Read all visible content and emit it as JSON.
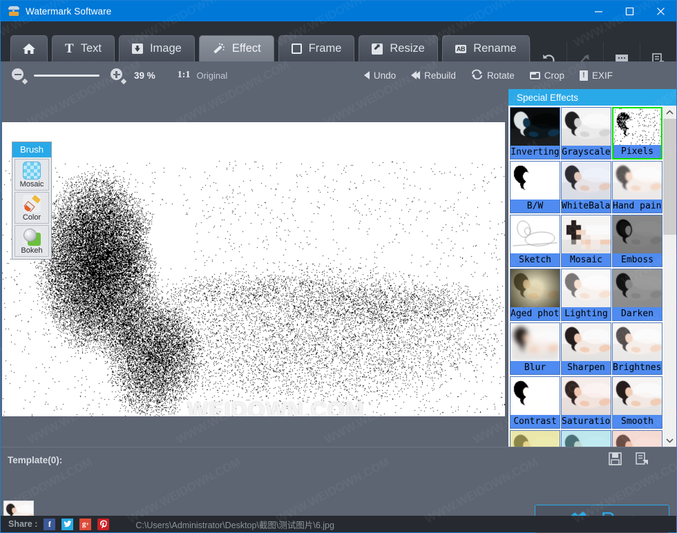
{
  "window": {
    "title": "Watermark Software",
    "icon": "app-lamp-icon",
    "minimize": "—",
    "maximize": "□",
    "close": "✕"
  },
  "tabs": [
    {
      "label": "",
      "icon": "home-icon",
      "active": false
    },
    {
      "label": "Text",
      "icon": "text-icon",
      "active": false
    },
    {
      "label": "Image",
      "icon": "image-icon",
      "active": false
    },
    {
      "label": "Effect",
      "icon": "magic-wand-icon",
      "active": true
    },
    {
      "label": "Frame",
      "icon": "frame-icon",
      "active": false
    },
    {
      "label": "Resize",
      "icon": "resize-icon",
      "active": false
    },
    {
      "label": "Rename",
      "icon": "rename-ab-icon",
      "active": false
    }
  ],
  "top_right_tools": [
    {
      "name": "undo-arrow-icon",
      "glyph": "↺",
      "dim": false
    },
    {
      "name": "redo-arrow-icon",
      "glyph": "⤴",
      "dim": true
    },
    {
      "name": "comment-icon",
      "glyph": "●●●",
      "dim": false
    },
    {
      "name": "batch-list-icon",
      "glyph": "὜B",
      "dim": false
    }
  ],
  "zoombar": {
    "zoom_out_icon": "zoom-out-icon",
    "zoom_in_icon": "zoom-in-icon",
    "zoom_value": "39 %",
    "ratio": "1:1",
    "ratio_label": "Original",
    "tools": [
      {
        "label": "Undo",
        "icon": "undo-triangle-icon"
      },
      {
        "label": "Rebuild",
        "icon": "rebuild-double-triangle-icon"
      },
      {
        "label": "Rotate",
        "icon": "rotate-icon"
      },
      {
        "label": "Crop",
        "icon": "crop-icon"
      },
      {
        "label": "EXIF",
        "icon": "exif-icon"
      }
    ]
  },
  "brush_panel": {
    "title": "Brush",
    "items": [
      {
        "label": "Mosaic",
        "icon": "mosaic-brush-icon"
      },
      {
        "label": "Color",
        "icon": "color-brush-icon"
      },
      {
        "label": "Bokeh",
        "icon": "bokeh-brush-icon"
      }
    ]
  },
  "canvas": {
    "watermark_text": "WEIDOWN.COM"
  },
  "special_effects": {
    "title": "Special Effects",
    "scroll_up_icon": "chevron-up-icon",
    "scroll_down_icon": "chevron-down-icon",
    "items": [
      {
        "label": "Inverting",
        "selected": false,
        "thumb": "inverting"
      },
      {
        "label": "Grayscale",
        "selected": false,
        "thumb": "grayscale"
      },
      {
        "label": "Pixels",
        "selected": true,
        "thumb": "pixels"
      },
      {
        "label": "B/W",
        "selected": false,
        "thumb": "bw"
      },
      {
        "label": "WhiteBalance",
        "selected": false,
        "thumb": "whitebalance"
      },
      {
        "label": "Hand painted",
        "selected": false,
        "thumb": "handpainted"
      },
      {
        "label": "Sketch",
        "selected": false,
        "thumb": "sketch"
      },
      {
        "label": "Mosaic",
        "selected": false,
        "thumb": "mosaic"
      },
      {
        "label": "Emboss",
        "selected": false,
        "thumb": "emboss"
      },
      {
        "label": "Aged photo",
        "selected": false,
        "thumb": "aged"
      },
      {
        "label": "Lighting",
        "selected": false,
        "thumb": "lighting"
      },
      {
        "label": "Darken",
        "selected": false,
        "thumb": "darken"
      },
      {
        "label": "Blur",
        "selected": false,
        "thumb": "blur"
      },
      {
        "label": "Sharpen",
        "selected": false,
        "thumb": "sharpen"
      },
      {
        "label": "Brightness",
        "selected": false,
        "thumb": "brightness"
      },
      {
        "label": "Contrast",
        "selected": false,
        "thumb": "contrast"
      },
      {
        "label": "Saturation",
        "selected": false,
        "thumb": "saturation"
      },
      {
        "label": "Smooth",
        "selected": false,
        "thumb": "smooth"
      },
      {
        "label": "",
        "selected": false,
        "thumb": "row7a"
      },
      {
        "label": "",
        "selected": false,
        "thumb": "row7b"
      },
      {
        "label": "",
        "selected": false,
        "thumb": "row7c"
      }
    ]
  },
  "template": {
    "label": "Template(0):",
    "save_icon": "save-floppy-icon",
    "load_icon": "load-template-icon",
    "run_label": "Run",
    "run_icon": "stamp-icon"
  },
  "statusbar": {
    "share_label": "Share :",
    "share_icons": [
      {
        "name": "facebook-icon",
        "glyph": "f"
      },
      {
        "name": "twitter-icon",
        "glyph": "ὂ6"
      },
      {
        "name": "googleplus-icon",
        "glyph": "g+"
      },
      {
        "name": "pinterest-icon",
        "glyph": "ᵍF"
      }
    ],
    "file_path": "C:\\Users\\Administrator\\Desktop\\截图\\测试图片\\6.jpg"
  },
  "colors": {
    "accent_blue": "#0078d7",
    "panel_header": "#2aa9e8",
    "chrome_gray": "#5d6472",
    "tabstrip_dark": "#2b2f36",
    "label_blue": "#4f8bf0",
    "selected_green": "#00e000",
    "statusbar_dark": "#262a30"
  }
}
